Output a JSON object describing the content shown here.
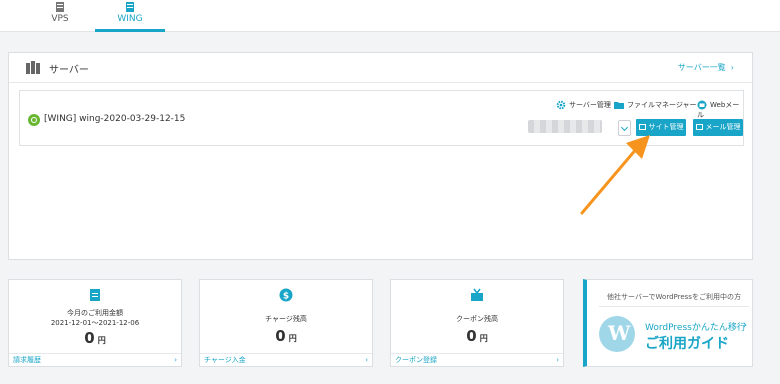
{
  "tabs": [
    {
      "label": "VPS",
      "active": false
    },
    {
      "label": "WING",
      "active": true
    }
  ],
  "server_panel": {
    "title": "サーバー",
    "list_link": "サーバー一覧",
    "row": {
      "name": "[WING] wing-2020-03-29-12-15",
      "status": "active",
      "tools": [
        "サーバー管理",
        "ファイルマネージャー",
        "Webメール"
      ],
      "site_button": "サイト管理",
      "mail_button": "メール管理"
    }
  },
  "cards": [
    {
      "title": "今月のご利用金額",
      "period": "2021-12-01〜2021-12-06",
      "amount": "0",
      "unit": "円",
      "footer": "請求履歴"
    },
    {
      "title": "チャージ残高",
      "amount": "0",
      "unit": "円",
      "footer": "チャージ入金"
    },
    {
      "title": "クーポン残高",
      "amount": "0",
      "unit": "円",
      "footer": "クーポン登録"
    }
  ],
  "guide": {
    "caption": "他社サーバーでWordPressをご利用中の方",
    "line1": "WordPressかんたん移行",
    "line2": "ご利用ガイド"
  },
  "colors": {
    "accent": "#19a5c7",
    "status": "#6ab733",
    "arrow": "#f7941d"
  }
}
